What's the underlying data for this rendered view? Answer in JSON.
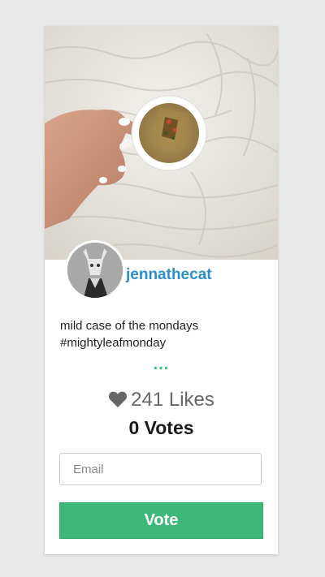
{
  "post": {
    "username": "jennathecat",
    "caption_line1": "mild case of the mondays",
    "caption_line2": "#mightyleafmonday",
    "more_label": "...",
    "likes_count": "241",
    "likes_label": "Likes",
    "votes_label": "0 Votes"
  },
  "form": {
    "email_placeholder": "Email",
    "email_value": "",
    "vote_label": "Vote"
  },
  "colors": {
    "username": "#2c8fc9",
    "vote_button": "#3cb878",
    "more_dots": "#3bbd7a",
    "background": "#e9e9e9"
  },
  "icons": {
    "likes": "heart-icon"
  }
}
